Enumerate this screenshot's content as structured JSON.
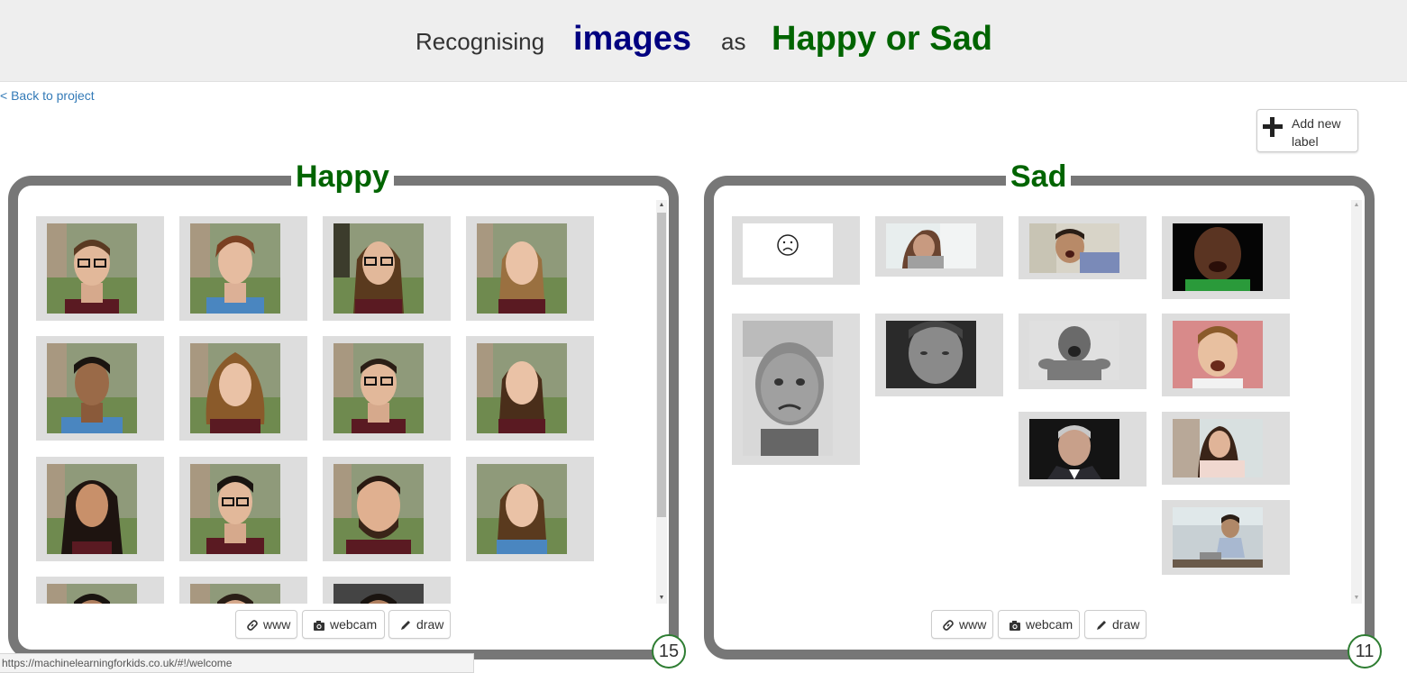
{
  "header": {
    "word_recognising": "Recognising",
    "word_type": "images",
    "word_as": "as",
    "word_project": "Happy or Sad"
  },
  "nav": {
    "back_link": "< Back to project"
  },
  "add_label": {
    "label": "Add new label",
    "icon": "plus-icon"
  },
  "buckets": [
    {
      "name": "Happy",
      "count": "15",
      "tools": {
        "www": "www",
        "webcam": "webcam",
        "draw": "draw"
      }
    },
    {
      "name": "Sad",
      "count": "11",
      "tools": {
        "www": "www",
        "webcam": "webcam",
        "draw": "draw"
      }
    }
  ],
  "status_bar": {
    "url": "https://machinelearningforkids.co.uk/#!/welcome"
  },
  "colors": {
    "title_images": "#000080",
    "title_label": "#006400",
    "bucket_border": "#777777",
    "card_bg": "#dddddd",
    "link": "#337ab7",
    "count_ring": "#2e7d32"
  }
}
